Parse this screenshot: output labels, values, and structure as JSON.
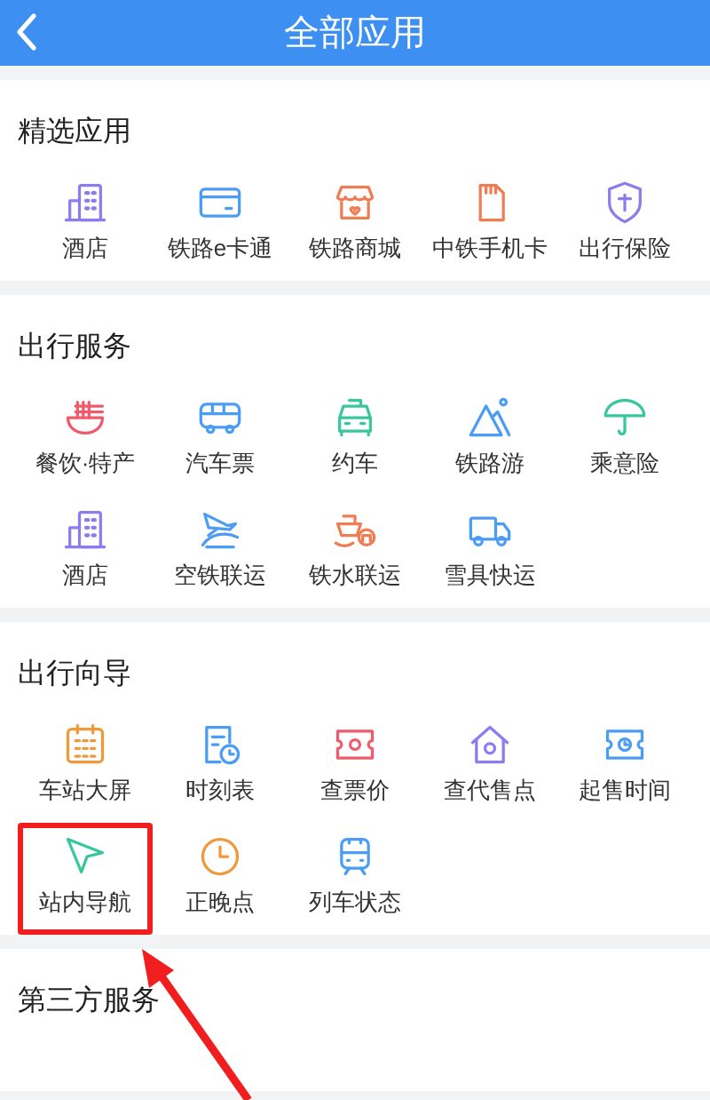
{
  "header": {
    "title": "全部应用"
  },
  "sections": [
    {
      "title": "精选应用",
      "items": [
        {
          "label": "酒店",
          "highlighted": false
        },
        {
          "label": "铁路e卡通",
          "highlighted": false
        },
        {
          "label": "铁路商城",
          "highlighted": false
        },
        {
          "label": "中铁手机卡",
          "highlighted": false
        },
        {
          "label": "出行保险",
          "highlighted": false
        }
      ]
    },
    {
      "title": "出行服务",
      "items": [
        {
          "label": "餐饮·特产",
          "highlighted": false
        },
        {
          "label": "汽车票",
          "highlighted": false
        },
        {
          "label": "约车",
          "highlighted": false
        },
        {
          "label": "铁路游",
          "highlighted": false
        },
        {
          "label": "乘意险",
          "highlighted": false
        },
        {
          "label": "酒店",
          "highlighted": false
        },
        {
          "label": "空铁联运",
          "highlighted": false
        },
        {
          "label": "铁水联运",
          "highlighted": false
        },
        {
          "label": "雪具快运",
          "highlighted": false
        }
      ]
    },
    {
      "title": "出行向导",
      "items": [
        {
          "label": "车站大屏",
          "highlighted": false
        },
        {
          "label": "时刻表",
          "highlighted": false
        },
        {
          "label": "查票价",
          "highlighted": false
        },
        {
          "label": "查代售点",
          "highlighted": false
        },
        {
          "label": "起售时间",
          "highlighted": false
        },
        {
          "label": "站内导航",
          "highlighted": true
        },
        {
          "label": "正晚点",
          "highlighted": false
        },
        {
          "label": "列车状态",
          "highlighted": false
        }
      ]
    },
    {
      "title": "第三方服务"
    }
  ]
}
